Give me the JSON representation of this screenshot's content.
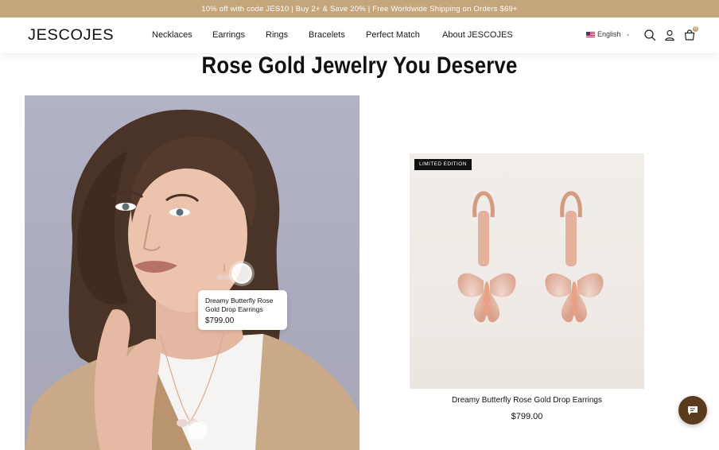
{
  "announcement": "10% off with code JES10 | Buy 2+ & Save 20% | Free Worldwide Shipping on Orders $69+",
  "header": {
    "logo": "JESCOJES",
    "nav": [
      "Necklaces",
      "Earrings",
      "Rings",
      "Bracelets",
      "Perfect Match",
      "About JESCOJES"
    ],
    "language": "English",
    "cart_count": "0",
    "icons": [
      "flag-us-icon",
      "chevron-down-icon",
      "search-icon",
      "account-icon",
      "cart-icon"
    ]
  },
  "section_title": "Rose Gold Jewelry You Deserve",
  "lookbook": {
    "tooltip": {
      "name": "Dreamy Butterfly Rose Gold Drop Earrings",
      "price": "$799.00"
    }
  },
  "product": {
    "badge": "LIMITED EDITION",
    "name": "Dreamy Butterfly Rose Gold Drop Earrings",
    "price": "$799.00"
  },
  "colors": {
    "announcement_bg": "#c5a57c",
    "chat_button": "#5b3a1d",
    "photo_bg": "#b0b1c4"
  }
}
